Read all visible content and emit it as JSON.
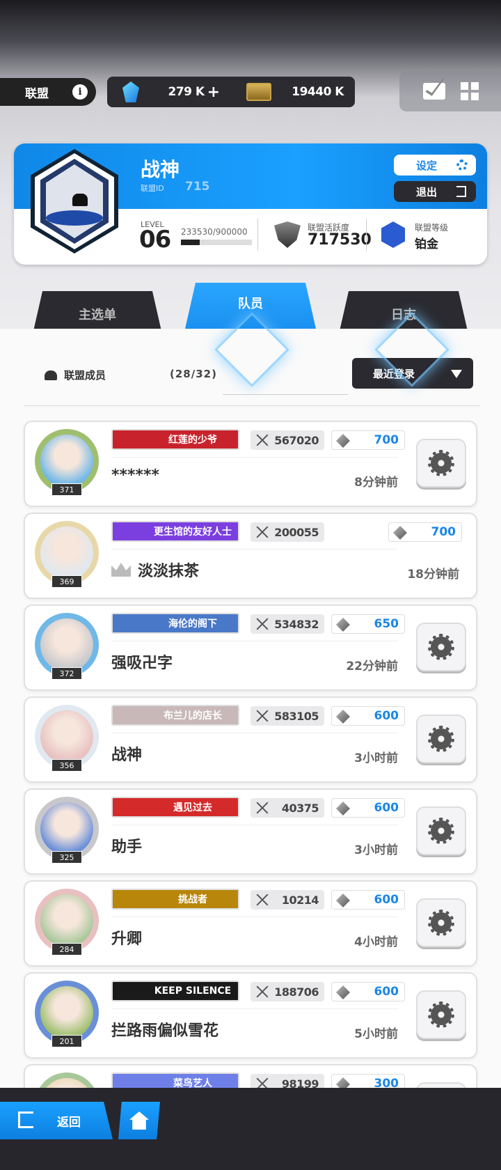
{
  "header": {
    "alliance_label": "联盟",
    "info_glyph": "i",
    "gems": "279 K",
    "gems_plus": "+",
    "cards": "19440 K"
  },
  "guild": {
    "name": "战神",
    "id_label": "联盟ID",
    "id": "715",
    "settings_label": "设定",
    "exit_label": "退出",
    "level_label": "LEVEL",
    "level": "06",
    "xp_text": "233530/900000",
    "xp_progress": 0.26,
    "activity_label": "联盟活跃度",
    "activity": "717530",
    "rank_label": "联盟等级",
    "rank": "铂金"
  },
  "tabs": [
    {
      "label": "主选单"
    },
    {
      "label": "队员"
    },
    {
      "label": "日志"
    }
  ],
  "members_header": {
    "label": "联盟成员",
    "count": "(28/32)",
    "sort": "最近登录"
  },
  "members": [
    {
      "level": "371",
      "title": "红莲的少爷",
      "title_color": "#c8232c",
      "power": "567020",
      "contrib": "700",
      "name": "******",
      "time": "8分钟前",
      "self": false
    },
    {
      "level": "369",
      "title": "更生馆的友好人士",
      "title_color": "#7b3fe0",
      "power": "200055",
      "contrib": "700",
      "name": "淡淡抹茶",
      "time": "18分钟前",
      "self": true
    },
    {
      "level": "372",
      "title": "海伦的阁下",
      "title_color": "#4a78c8",
      "power": "534832",
      "contrib": "650",
      "name": "强吸卍字",
      "time": "22分钟前",
      "self": false
    },
    {
      "level": "356",
      "title": "布兰儿的店长",
      "title_color": "#c9b8b8",
      "power": "583105",
      "contrib": "600",
      "name": "战神",
      "time": "3小时前",
      "self": false
    },
    {
      "level": "325",
      "title": "遇见过去",
      "title_color": "#d42a2a",
      "power": "40375",
      "contrib": "600",
      "name": "助手",
      "time": "3小时前",
      "self": false
    },
    {
      "level": "284",
      "title": "挑战者",
      "title_color": "#b8860b",
      "power": "10214",
      "contrib": "600",
      "name": "升卿",
      "time": "4小时前",
      "self": false
    },
    {
      "level": "201",
      "title": "KEEP SILENCE",
      "title_color": "#1a1a1a",
      "power": "188706",
      "contrib": "600",
      "name": "拦路雨偏似雪花",
      "time": "5小时前",
      "self": false
    },
    {
      "level": "",
      "title": "菜鸟艺人",
      "title_color": "#6f7fe8",
      "power": "98199",
      "contrib": "300",
      "name": "",
      "time": "",
      "self": false
    }
  ],
  "footer": {
    "back_label": "返回"
  },
  "icons": [
    "info-icon",
    "gem-icon",
    "card-icon",
    "mail-icon",
    "grid-icon",
    "gear-icon",
    "exit-icon",
    "shield-icon",
    "rank-icon",
    "people-icon",
    "dropdown-arrow-icon",
    "sword-icon",
    "diamond-icon",
    "crown-icon",
    "back-icon",
    "home-icon"
  ]
}
